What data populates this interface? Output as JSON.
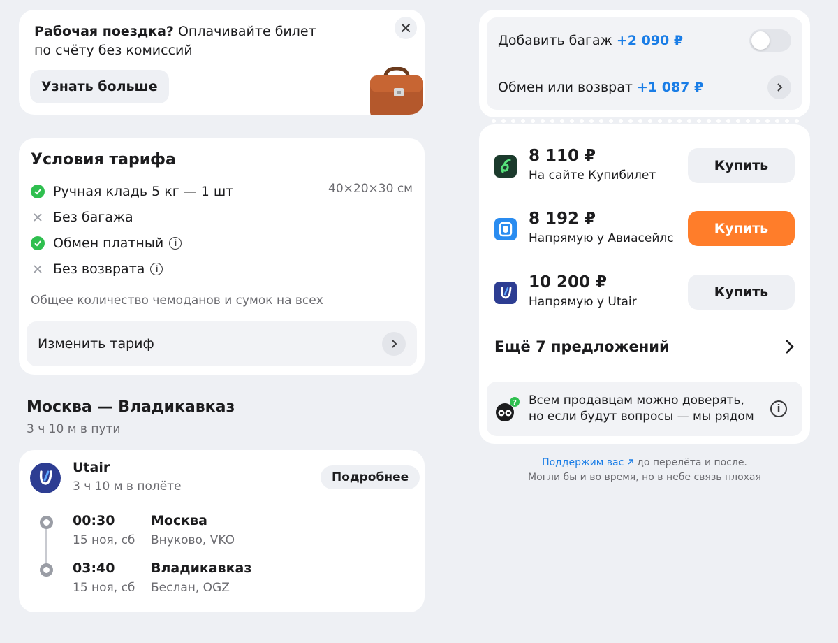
{
  "promo": {
    "title_bold": "Рабочая поездка?",
    "title_rest": " Оплачивайте билет по счёту без комиссий",
    "button": "Узнать больше"
  },
  "tariff": {
    "title": "Условия тарифа",
    "items": [
      {
        "label": "Ручная кладь 5 кг — 1 шт",
        "status": "check",
        "extra": "40×20×30 см"
      },
      {
        "label": "Без багажа",
        "status": "cross"
      },
      {
        "label": "Обмен платный",
        "status": "check",
        "info": true
      },
      {
        "label": "Без возврата",
        "status": "cross",
        "info": true
      }
    ],
    "note": "Общее количество чемоданов и сумок на всех",
    "change_button": "Изменить тариф"
  },
  "route": {
    "title": "Москва — Владикавказ",
    "subtitle": "3 ч 10 м в пути"
  },
  "flight": {
    "airline": "Utair",
    "duration": "3 ч 10 м в полёте",
    "details_button": "Подробнее",
    "departure": {
      "time": "00:30",
      "date": "15 ноя, сб",
      "city": "Москва",
      "airport": "Внуково, VKO"
    },
    "arrival": {
      "time": "03:40",
      "date": "15 ноя, сб",
      "city": "Владикавказ",
      "airport": "Беслан, OGZ"
    }
  },
  "extras": {
    "baggage_label": "Добавить багаж",
    "baggage_price": "+2 090 ₽",
    "baggage_enabled": false,
    "exchange_label": "Обмен или возврат",
    "exchange_price": "+1 087 ₽"
  },
  "offers": [
    {
      "price": "8 110 ₽",
      "seller": "На сайте Купибилет",
      "button": "Купить",
      "icon": "kupibilet-icon"
    },
    {
      "price": "8 192 ₽",
      "seller": "Напрямую у Авиасейлс",
      "button": "Купить",
      "icon": "aviasales-icon",
      "primary": true
    },
    {
      "price": "10 200 ₽",
      "seller": "Напрямую у Utair",
      "button": "Купить",
      "icon": "utair-icon"
    }
  ],
  "more_offers": "Ещё 7 предложений",
  "trust": {
    "line1": "Всем продавцам можно доверять,",
    "line2": "но если будут вопросы — мы рядом"
  },
  "footer": {
    "link": "Поддержим вас",
    "after_link": " до перелёта и после.",
    "line2": "Могли бы и во время, но в небе связь плохая"
  },
  "colors": {
    "accent": "#ff7d2a",
    "link": "#1a7de6",
    "success": "#2fbf4f",
    "utair": "#2d3d92"
  }
}
